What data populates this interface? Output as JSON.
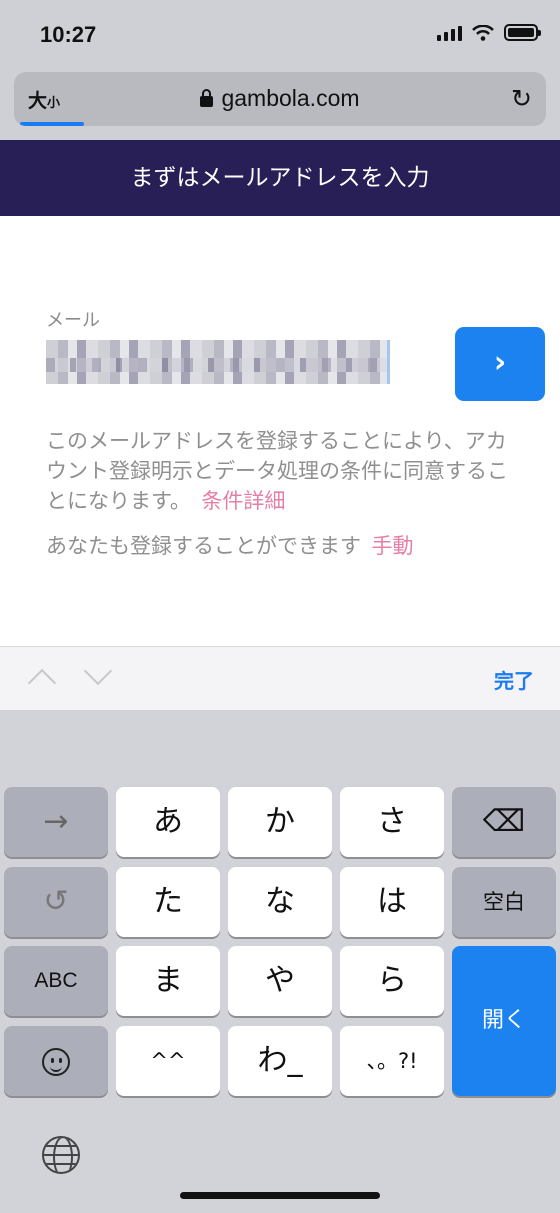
{
  "status": {
    "time": "10:27"
  },
  "browser": {
    "text_size_label": "大",
    "text_size_small": "小",
    "url": "gambola.com",
    "reload_glyph": "↻"
  },
  "page": {
    "header": "まずはメールアドレスを入力",
    "email_label": "メール",
    "go_glyph": "›",
    "terms_text": "このメールアドレスを登録することにより、アカウント登録明示とデータ処理の条件に同意することになります。",
    "terms_link": "条件詳細",
    "register_text": "あなたも登録することができます",
    "register_link": "手動"
  },
  "toolbar": {
    "done": "完了"
  },
  "keyboard": {
    "row1": [
      "→",
      "あ",
      "か",
      "さ",
      "⌫"
    ],
    "row2": [
      "↺",
      "た",
      "な",
      "は",
      "空白"
    ],
    "row3": [
      "ABC",
      "ま",
      "や",
      "ら"
    ],
    "row4": [
      "^^",
      "わ_",
      "、。?!"
    ],
    "open": "開く"
  },
  "colors": {
    "header_bg": "#291f57",
    "accent": "#1b82f0",
    "link": "#e67fa7"
  }
}
